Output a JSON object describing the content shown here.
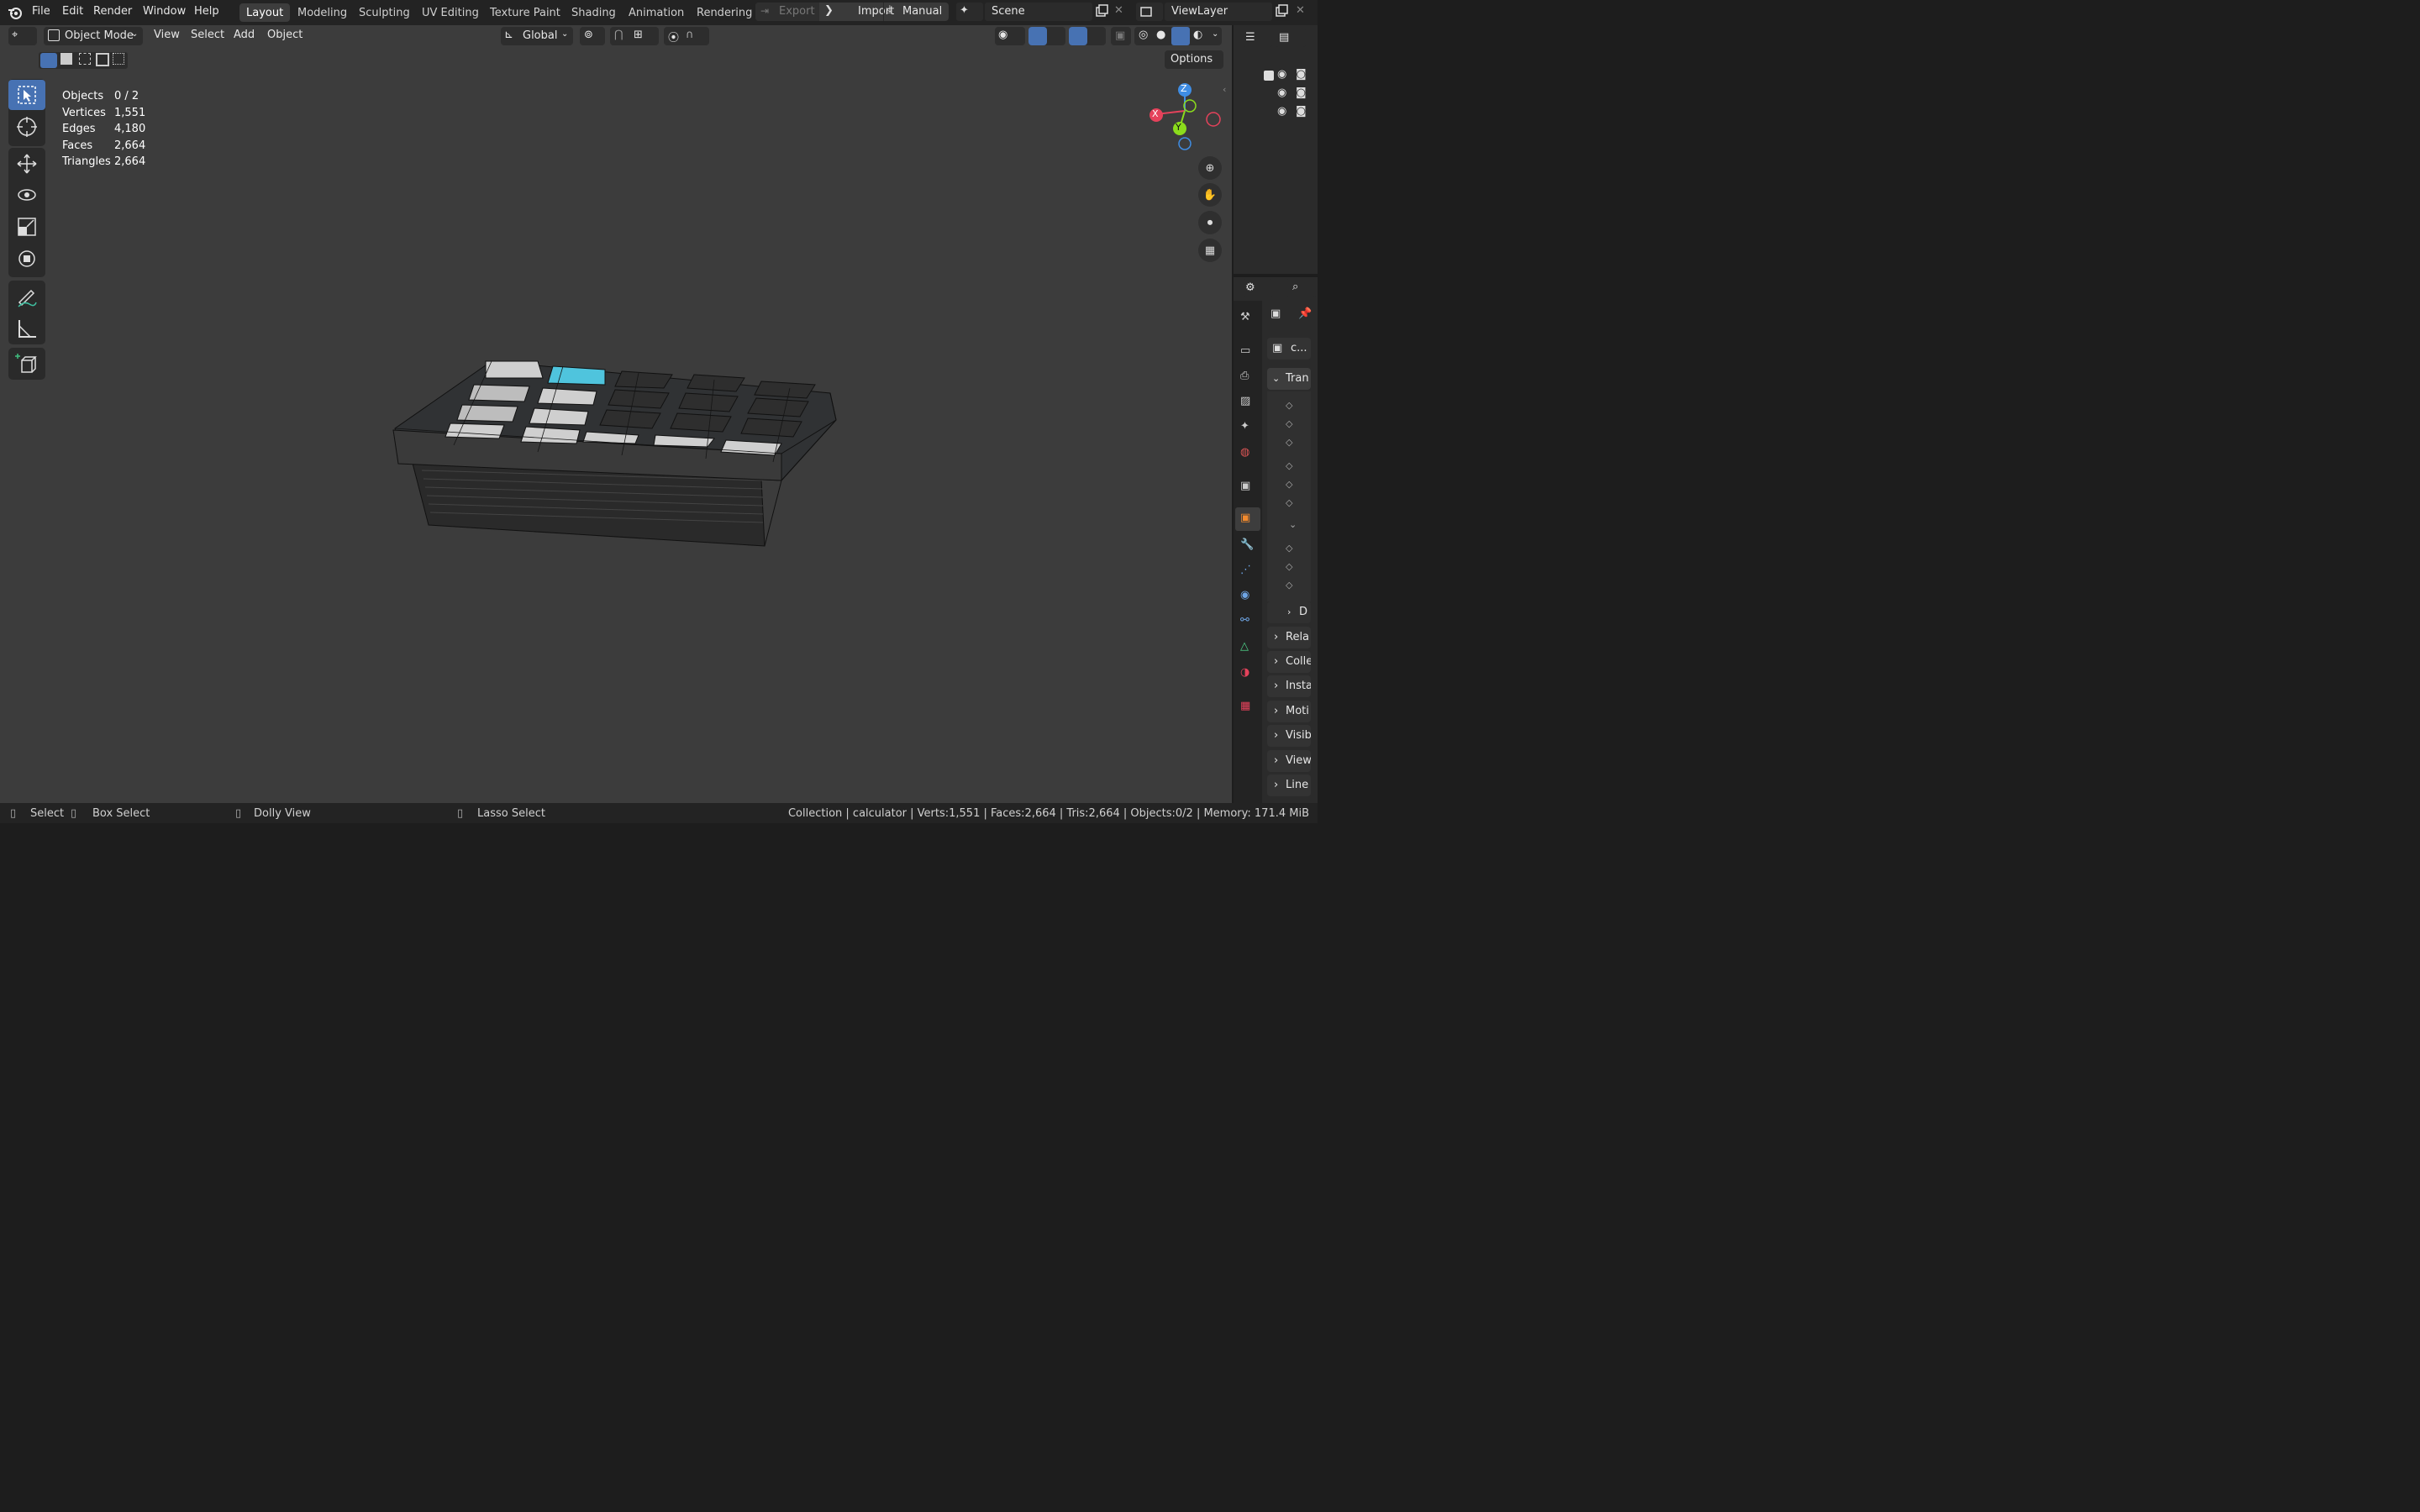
{
  "topbar": {
    "menus": [
      "File",
      "Edit",
      "Render",
      "Window",
      "Help"
    ],
    "workspaces": [
      "Layout",
      "Modeling",
      "Sculpting",
      "UV Editing",
      "Texture Paint",
      "Shading",
      "Animation",
      "Rendering"
    ],
    "active_workspace": "Layout",
    "export_label": "Export",
    "import_label": "Import",
    "manual_label": "Manual",
    "scene_name": "Scene",
    "view_layer_name": "ViewLayer"
  },
  "viewport_header": {
    "mode": "Object Mode",
    "menus": [
      "View",
      "Select",
      "Add",
      "Object"
    ],
    "orientation": "Global",
    "options_label": "Options"
  },
  "stats": {
    "rows": [
      {
        "label": "Objects",
        "value": "0 / 2"
      },
      {
        "label": "Vertices",
        "value": "1,551"
      },
      {
        "label": "Edges",
        "value": "4,180"
      },
      {
        "label": "Faces",
        "value": "2,664"
      },
      {
        "label": "Triangles",
        "value": "2,664"
      }
    ]
  },
  "gizmo": {
    "z": "Z",
    "y": "Y",
    "x": "X"
  },
  "properties": {
    "object_name": "c...",
    "transform_panel": "Tran",
    "sub_panel": "D",
    "panels": [
      "Rela",
      "Colle",
      "Insta",
      "Moti",
      "Visib",
      "View",
      "Line"
    ]
  },
  "statusbar": {
    "select": "Select",
    "box_select": "Box Select",
    "dolly_view": "Dolly View",
    "lasso_select": "Lasso Select",
    "info": "Collection | calculator | Verts:1,551 | Faces:2,664 | Tris:2,664 | Objects:0/2 | Memory: 171.4 MiB"
  },
  "colors": {
    "viewport_bg": "#3c3c3c",
    "header_bg": "#232323",
    "accent_blue": "#4772b3",
    "highlight_key": "#4fc4dd",
    "axis_x": "#e5425b",
    "axis_y": "#8bdc1c",
    "axis_z": "#3f8de4"
  }
}
